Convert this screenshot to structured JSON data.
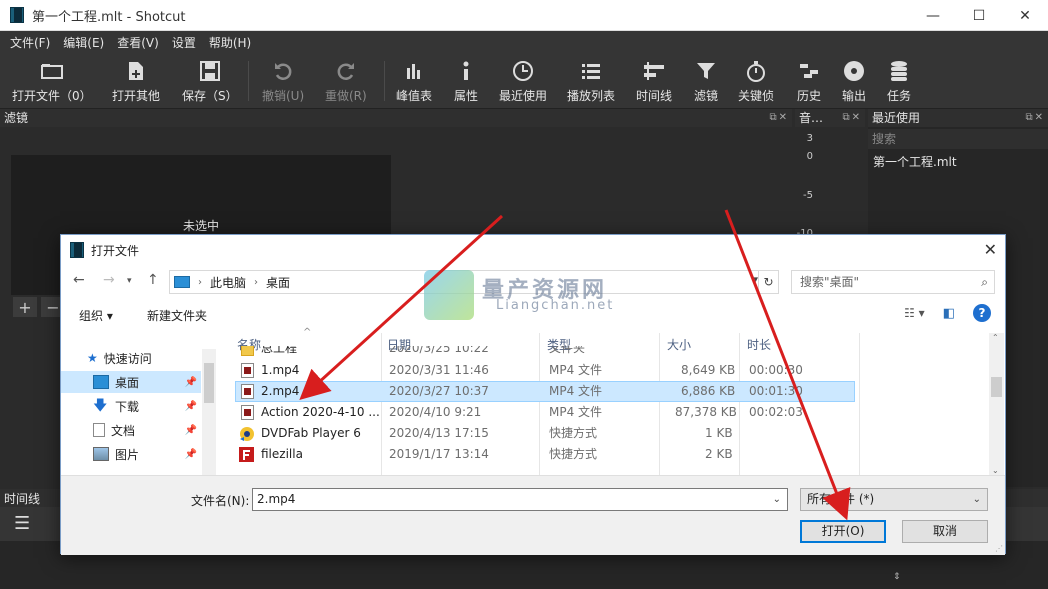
{
  "window": {
    "title": "第一个工程.mlt - Shotcut",
    "min": "—",
    "max": "☐",
    "close": "✕"
  },
  "menu": [
    "文件(F)",
    "编辑(E)",
    "查看(V)",
    "设置",
    "帮助(H)"
  ],
  "toolbar": {
    "open": "打开文件（0）",
    "open_other": "打开其他",
    "save": "保存（S）",
    "undo": "撤销(U)",
    "redo": "重做(R)",
    "peak": "峰值表",
    "props": "属性",
    "recent": "最近使用",
    "playlist": "播放列表",
    "timeline": "时间线",
    "filters": "滤镜",
    "keyframes": "关键侦",
    "history": "历史",
    "export": "输出",
    "jobs": "任务"
  },
  "panels": {
    "filters": "滤镜",
    "filters_empty": "未选中",
    "meter": "音…",
    "recent": "最近使用",
    "recent_search": "搜索",
    "recent_item": "第一个工程.mlt",
    "timeline": "时间线",
    "meter_scale": [
      "3",
      "0",
      "-5",
      "-10"
    ]
  },
  "dialog": {
    "title": "打开文件",
    "breadcrumb": [
      "此电脑",
      "桌面"
    ],
    "search_placeholder": "搜索\"桌面\"",
    "organize": "组织 ▾",
    "new_folder": "新建文件夹",
    "nav": [
      {
        "label": "快速访问",
        "icon": "star-icon"
      },
      {
        "label": "桌面",
        "icon": "desktop-icon",
        "selected": true
      },
      {
        "label": "下载",
        "icon": "download-icon"
      },
      {
        "label": "文档",
        "icon": "document-icon"
      },
      {
        "label": "图片",
        "icon": "picture-icon"
      }
    ],
    "columns": {
      "name": "名称",
      "date": "日期",
      "type": "类型",
      "size": "大小",
      "duration": "时长"
    },
    "files": [
      {
        "name": "总工程",
        "date": "2020/3/25 10:22",
        "type": "文件夹",
        "size": "",
        "duration": ""
      },
      {
        "name": "1.mp4",
        "date": "2020/3/31 11:46",
        "type": "MP4 文件",
        "size": "8,649 KB",
        "duration": "00:00:30"
      },
      {
        "name": "2.mp4",
        "date": "2020/3/27 10:37",
        "type": "MP4 文件",
        "size": "6,886 KB",
        "duration": "00:01:30"
      },
      {
        "name": "Action 2020-4-10 ...",
        "date": "2020/4/10 9:21",
        "type": "MP4 文件",
        "size": "87,378 KB",
        "duration": "00:02:03"
      },
      {
        "name": "DVDFab Player 6",
        "date": "2020/4/13 17:15",
        "type": "快捷方式",
        "size": "1 KB",
        "duration": ""
      },
      {
        "name": "filezilla",
        "date": "2019/1/17 13:14",
        "type": "快捷方式",
        "size": "2 KB",
        "duration": ""
      }
    ],
    "filename_label": "文件名(N):",
    "filename_value": "2.mp4",
    "filetype": "所有文件 (*)",
    "open_btn": "打开(O)",
    "cancel_btn": "取消"
  },
  "watermark": {
    "cn": "量产资源网",
    "en": "Liangchan.net"
  },
  "colors": {
    "accent": "#0078d7",
    "arrow": "#d81e1e",
    "selection": "#cce8ff"
  }
}
